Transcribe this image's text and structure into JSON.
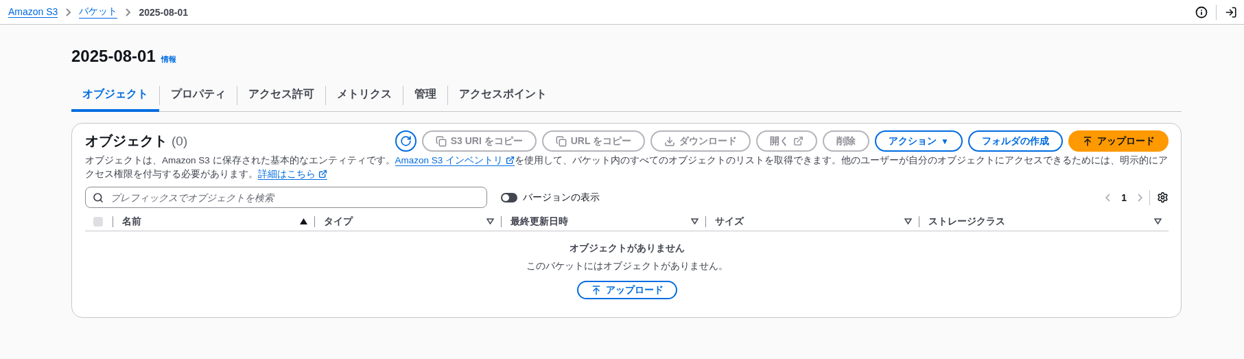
{
  "breadcrumbs": [
    {
      "label": "Amazon S3",
      "link": true
    },
    {
      "label": "バケット",
      "link": true
    },
    {
      "label": "2025-08-01",
      "link": false
    }
  ],
  "page": {
    "title": "2025-08-01",
    "info": "情報"
  },
  "tabs": [
    {
      "label": "オブジェクト",
      "selected": true
    },
    {
      "label": "プロパティ",
      "selected": false
    },
    {
      "label": "アクセス許可",
      "selected": false
    },
    {
      "label": "メトリクス",
      "selected": false
    },
    {
      "label": "管理",
      "selected": false
    },
    {
      "label": "アクセスポイント",
      "selected": false
    }
  ],
  "panel": {
    "title": "オブジェクト",
    "count": "(0)",
    "buttons": [
      {
        "kind": "icon",
        "disabled": false
      },
      {
        "kind": "normal",
        "label": "S3 URI をコピー",
        "disabled": true
      },
      {
        "kind": "normal",
        "label": "URL をコピー",
        "disabled": true
      },
      {
        "kind": "normal",
        "label": "ダウンロード",
        "disabled": true
      },
      {
        "kind": "normal",
        "label": "開く",
        "disabled": true
      },
      {
        "kind": "normal",
        "label": "削除",
        "disabled": true
      },
      {
        "kind": "dropdown",
        "label": "アクション",
        "caret": "▼",
        "disabled": false
      },
      {
        "kind": "normal",
        "label": "フォルダの作成",
        "disabled": false
      },
      {
        "kind": "primary",
        "label": "アップロード",
        "disabled": false
      }
    ],
    "description": [
      {
        "kind": "text",
        "text": "オブジェクトは、Amazon S3 に保存された基本的なエンティティです。"
      },
      {
        "kind": "link",
        "text": "Amazon S3 インベントリ"
      },
      {
        "kind": "text",
        "text": "を使用して、バケット内のすべてのオブジェクトのリストを取得できます。他のユーザーが自分のオブジェクトにアクセスできるためには、明示的にアクセス権限を付与する必要があります。"
      },
      {
        "kind": "link",
        "text": "詳細はこちら"
      }
    ],
    "search": {
      "placeholder": "プレフィックスでオブジェクトを検索"
    },
    "versions_toggle": {
      "label": "バージョンの表示",
      "on": false
    },
    "pagination": {
      "page": "1",
      "prev_disabled": true,
      "next_disabled": true
    },
    "table": {
      "select_all": {
        "checked": false,
        "disabled": true
      },
      "columns": [
        {
          "label": "名前",
          "sorted": true
        },
        {
          "label": "タイプ",
          "sorted": false
        },
        {
          "label": "最終更新日時",
          "sorted": false
        },
        {
          "label": "サイズ",
          "sorted": false
        },
        {
          "label": "ストレージクラス",
          "sorted": false
        }
      ],
      "empty": {
        "title": "オブジェクトがありません",
        "message": "このバケットにはオブジェクトがありません。",
        "button": "アップロード"
      }
    }
  }
}
